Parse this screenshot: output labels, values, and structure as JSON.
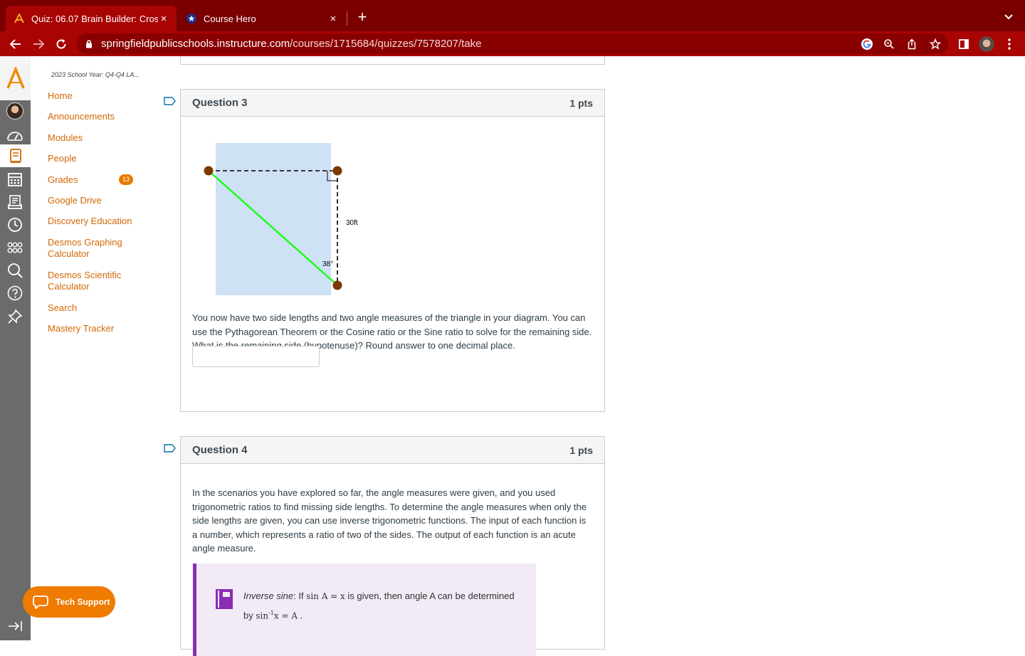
{
  "browser": {
    "tabs": [
      {
        "title": "Quiz: 06.07 Brain Builder: Cros",
        "close": "×"
      },
      {
        "title": "Course Hero",
        "close": "×"
      }
    ],
    "new_tab": "+",
    "url_domain": "springfieldpublicschools.instructure.com",
    "url_path": "/courses/1715684/quizzes/7578207/take"
  },
  "course_nav": {
    "term": "2023 School Year: Q4-Q4 LA...",
    "items": [
      "Home",
      "Announcements",
      "Modules",
      "People",
      "Grades",
      "Google Drive",
      "Discovery Education",
      "Desmos Graphing Calculator",
      "Desmos Scientific Calculator",
      "Search",
      "Mastery Tracker"
    ],
    "grades_badge": "13"
  },
  "question3": {
    "title": "Question 3",
    "points": "1 pts",
    "diagram": {
      "side_label": "30ft",
      "angle_label": "38°"
    },
    "text": "You now have two side lengths and two angle measures of the triangle in your diagram. You can use the Pythagorean Theorem or the Cosine ratio or the Sine ratio to solve for the remaining side. What is the remaining side (hypotenuse)? Round answer to one decimal place.",
    "answer_value": ""
  },
  "question4": {
    "title": "Question 4",
    "points": "1 pts",
    "text": "In the scenarios you have explored so far, the angle measures were given, and you used trigonometric ratios to find missing side lengths. To determine the angle measures when only the side lengths are given, you can use inverse trigonometric functions. The input of each function is a number, which represents a ratio of two of the sides. The output of each function is an acute angle measure.",
    "callout": {
      "term": "Inverse sine",
      "line1_pre": ": If ",
      "math1": "sin A = x",
      "line1_post": " is given, then angle A can be determined",
      "line2_pre": "by ",
      "math2_a": "sin",
      "math2_sup": "-1",
      "math2_b": "x = A",
      "line2_post": " ."
    }
  },
  "tech_support": "Tech Support",
  "colors": {
    "brand": "#a80404",
    "link": "#d26806",
    "accent": "#ea7a00"
  }
}
